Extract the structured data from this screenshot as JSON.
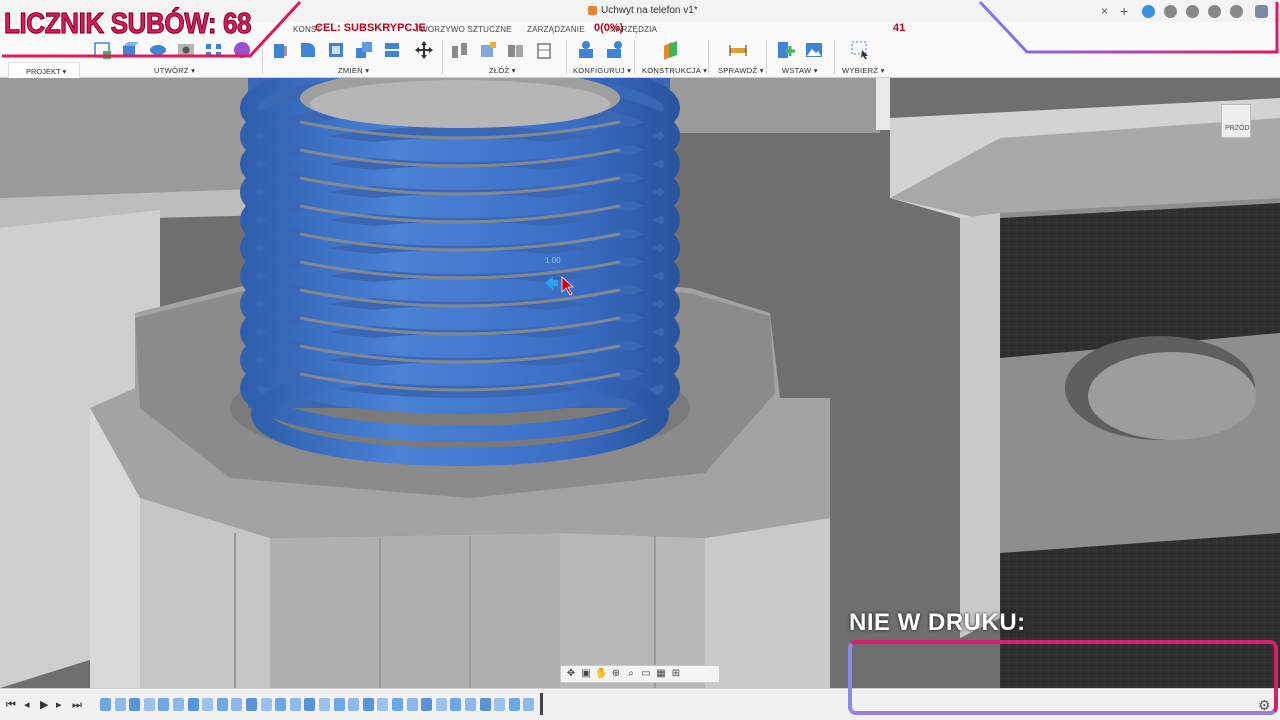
{
  "app": {
    "document_title": "Uchwyt na telefon v1*"
  },
  "tabs": [
    {
      "label": "KONST"
    },
    {
      "label": "TWORZYWO SZTUCZNE"
    },
    {
      "label": "ZARZĄDZANIE"
    },
    {
      "label": "NARZĘDZIA"
    }
  ],
  "toolbar": {
    "project_label": "PROJEKT ▾",
    "groups": [
      {
        "label": "UTWÓRZ ▾"
      },
      {
        "label": "ZMIEŃ ▾"
      },
      {
        "label": "ZŁÓŻ ▾"
      },
      {
        "label": "KONFIGURUJ ▾"
      },
      {
        "label": "KONSTRUKCJA ▾"
      },
      {
        "label": "SPRAWDŹ ▾"
      },
      {
        "label": "WSTAW ▾"
      },
      {
        "label": "WYBIERZ ▾"
      }
    ]
  },
  "view_cube": {
    "face_label": "PRZÓD"
  },
  "viewport": {
    "dimension_value": "1.00"
  },
  "overlay": {
    "sub_counter": "LICZNIK SUBÓW: 68",
    "goal_label": "CEL: SUBSKRYPCJE",
    "goal_progress": "0(0%)",
    "goal_target": "41",
    "not_printed_label": "NIE W DRUKU:"
  },
  "colors": {
    "thread_blue": "#3d72c9",
    "overlay_pink": "#e0195a",
    "ribbon_bg": "#fafafa"
  },
  "timeline": {
    "icons": [
      "play-first-icon",
      "play-prev-icon",
      "play-icon",
      "play-next-icon",
      "play-last-icon"
    ]
  }
}
